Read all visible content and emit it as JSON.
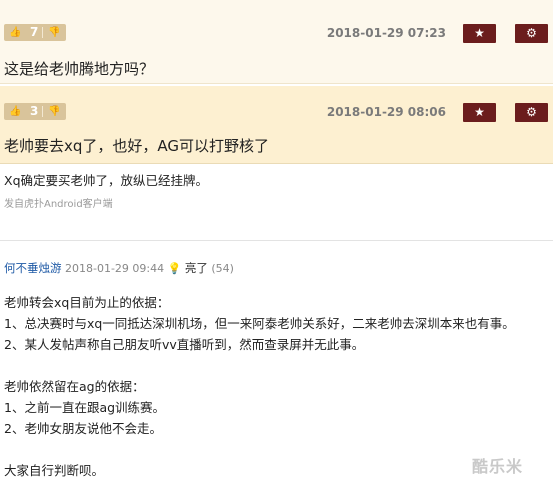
{
  "comments": [
    {
      "votes": "7",
      "timestamp": "2018-01-29 07:23",
      "text": "这是给老帅腾地方吗？"
    },
    {
      "votes": "3",
      "timestamp": "2018-01-29 08:06",
      "text": "老帅要去xq了，也好，AG可以打野核了"
    }
  ],
  "post1": {
    "text": "Xq确定要买老帅了，放纵已经挂牌。",
    "from": "发自虎扑Android客户端"
  },
  "post2": {
    "username": "何不垂烛游",
    "date": "2018-01-29 09:44",
    "light_label": "亮了",
    "light_count": "(54)",
    "lines": [
      "老帅转会xq目前为止的依据：",
      "1、总决赛时与xq一同抵达深圳机场，但一来阿泰老帅关系好，二来老帅去深圳本来也有事。",
      "2、某人发帖声称自己朋友听vv直播听到，然而查录屏并无此事。",
      "",
      "老帅依然留在ag的依据：",
      "1、之前一直在跟ag训练赛。",
      "2、老帅女朋友说他不会走。",
      "",
      "大家自行判断呗。"
    ]
  },
  "watermark": "酷乐米",
  "icons": {
    "thumb_up": "thumbs-up-icon",
    "thumb_down": "thumbs-down-icon",
    "star": "star-icon",
    "gear": "gear-icon",
    "bulb": "lightbulb-icon"
  },
  "colors": {
    "vote_bg": "#d9c49b",
    "action_bg": "#6b1d1d",
    "comment1_bg": "#fdf8ec",
    "comment2_bg": "#fdf0d1",
    "username": "#1f5aa6"
  }
}
